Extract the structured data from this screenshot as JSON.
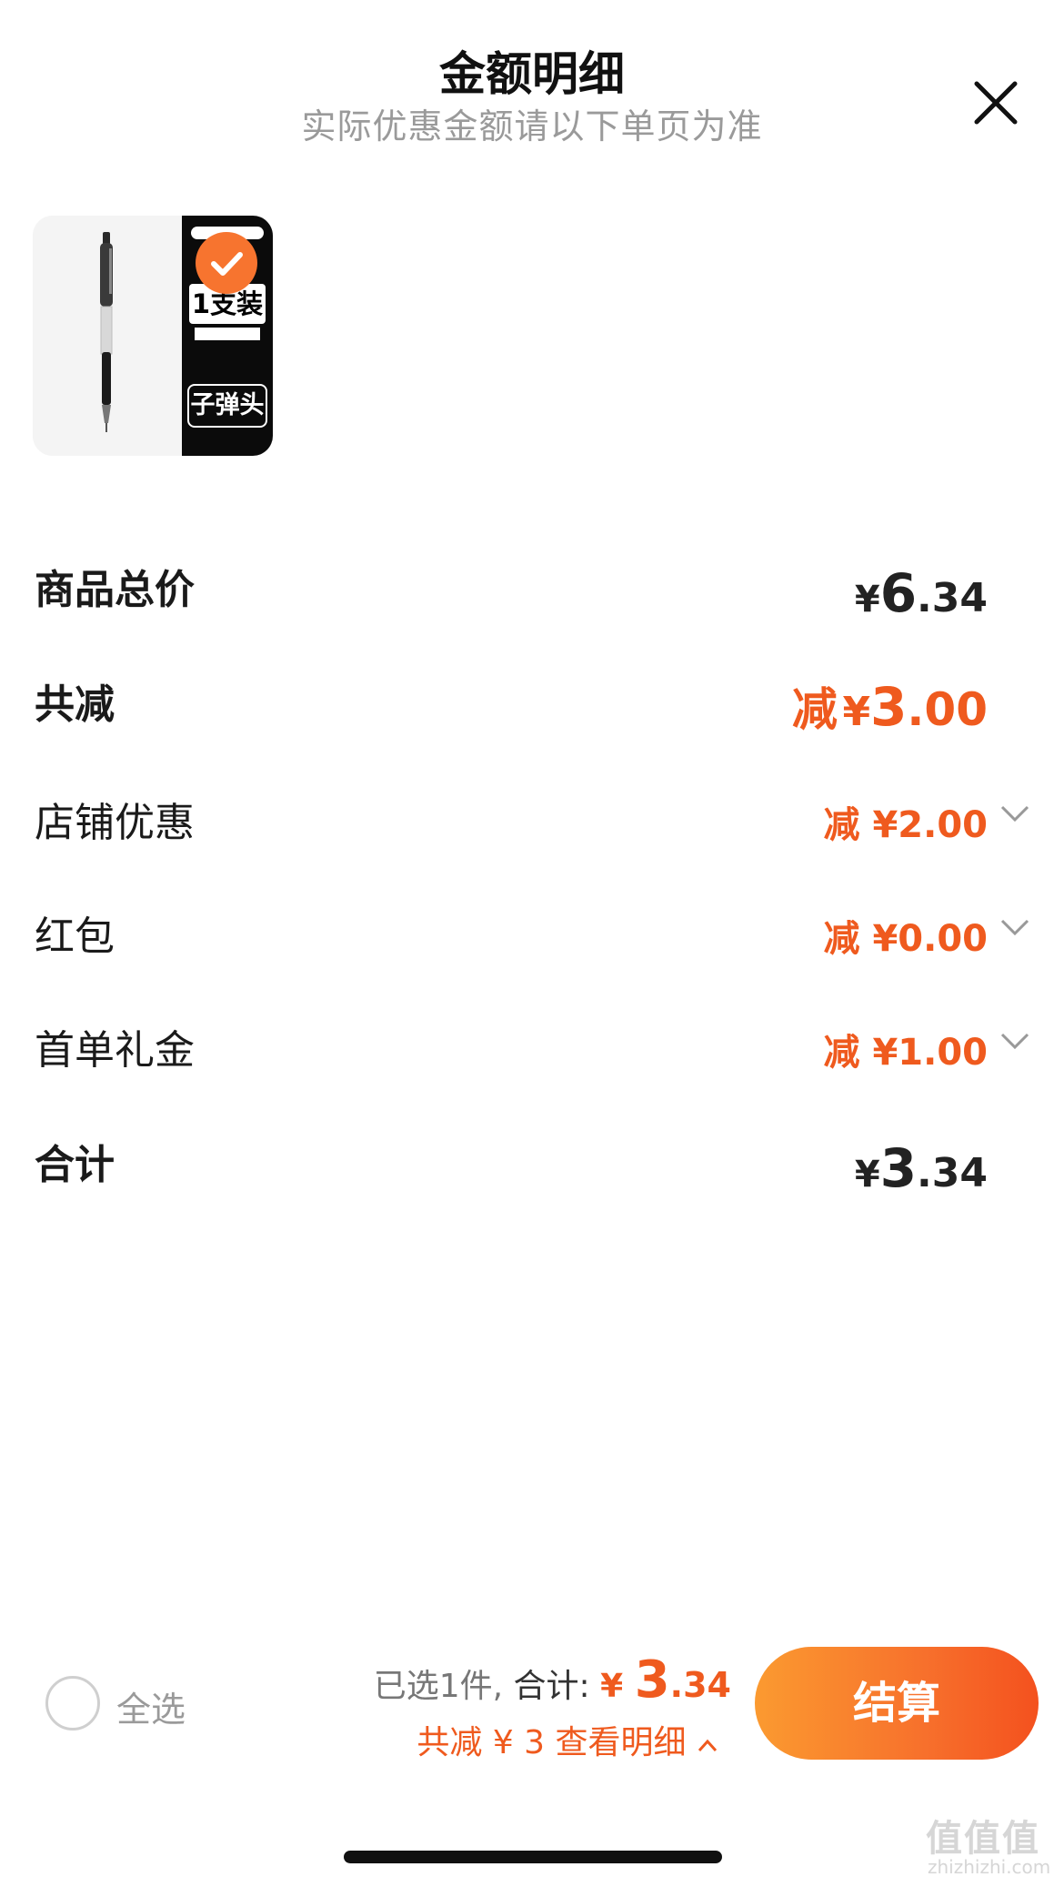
{
  "header": {
    "title": "金额明细",
    "subtitle": "实际优惠金额请以下单页为准",
    "close_icon": "close-icon"
  },
  "product": {
    "thumb_pack_label": "1支装",
    "thumb_bullet_label": "子弹头",
    "selected": true,
    "check_icon": "check-icon"
  },
  "summary": {
    "subtotal": {
      "label": "商品总价",
      "currency": "¥",
      "int": "6",
      "dec": ".34"
    },
    "total_discount": {
      "label": "共减",
      "prefix": "减",
      "currency": "¥",
      "int": "3",
      "dec": ".00"
    },
    "items": [
      {
        "label": "店铺优惠",
        "prefix": "减",
        "currency": "¥",
        "amount": "2.00"
      },
      {
        "label": "红包",
        "prefix": "减",
        "currency": "¥",
        "amount": "0.00"
      },
      {
        "label": "首单礼金",
        "prefix": "减",
        "currency": "¥",
        "amount": "1.00"
      }
    ],
    "total": {
      "label": "合计",
      "currency": "¥",
      "int": "3",
      "dec": ".34"
    }
  },
  "bottom_bar": {
    "select_all_label": "全选",
    "selected_text": "已选1件,",
    "total_label": "合计:",
    "total_currency": "¥",
    "total_int": "3",
    "total_dec": ".34",
    "discount_text": "共减 ¥ 3",
    "detail_link": "查看明细",
    "checkout_label": "结算"
  },
  "watermark": {
    "brand": "值值值",
    "site": "zhizhizhi.com"
  },
  "colors": {
    "accent": "#ef5a1e",
    "checkout_start": "#fb9a30",
    "checkout_end": "#f4511e",
    "muted": "#9a9a9a"
  }
}
